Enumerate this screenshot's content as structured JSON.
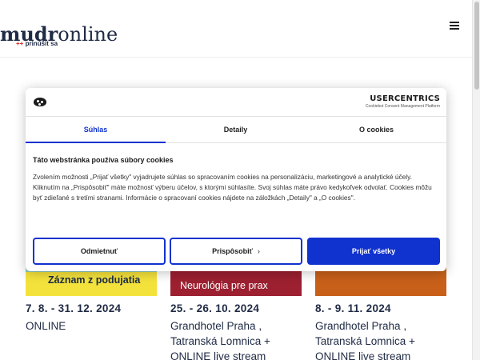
{
  "header": {
    "logo_bold": "mudr",
    "logo_light": "online",
    "tagline_mark": "++",
    "tagline": "prinúšit sa"
  },
  "events": [
    {
      "caption": "Záznam z podujatia",
      "date": "7. 8. - 31. 12. 2024",
      "location": "ONLINE"
    },
    {
      "caption": "Neurológia pre prax",
      "date": "25. - 26. 10. 2024",
      "location": "Grandhotel Praha , Tatranská Lomnica + ONLINE live stream"
    },
    {
      "caption": "",
      "date": "8. - 9. 11. 2024",
      "location": "Grandhotel Praha , Tatranská Lomnica + ONLINE live stream"
    }
  ],
  "consent": {
    "brand_name": "USERCENTRICS",
    "brand_sub": "Cookiebot Consent Management Platform",
    "tabs": [
      "Súhlas",
      "Detaily",
      "O cookies"
    ],
    "title": "Táto webstránka používa súbory cookies",
    "text": "Zvolením možnosti „Prijať všetky\" vyjadrujete súhlas so spracovaním cookies na personalizáciu, marketingové a analytické účely. Kliknutím na „Prispôsobiť\" máte možnosť výberu účelov, s ktorými súhlasíte. Svoj súhlas máte právo kedykoľvek odvolať. Cookies môžu byť zdieľané s tretími stranami. Informácie o spracovaní cookies nájdete na záložkách „Detaily\" a „O cookies\".",
    "btn_reject": "Odmietnuť",
    "btn_customize": "Prispôsobiť",
    "btn_accept": "Prijať všetky"
  },
  "icons": {
    "cookie": "cookie-icon",
    "menu": "hamburger-menu-icon",
    "chevron": "chevron-right-icon"
  },
  "colors": {
    "accent": "#1032cf",
    "brand_navy": "#1f2a44"
  }
}
